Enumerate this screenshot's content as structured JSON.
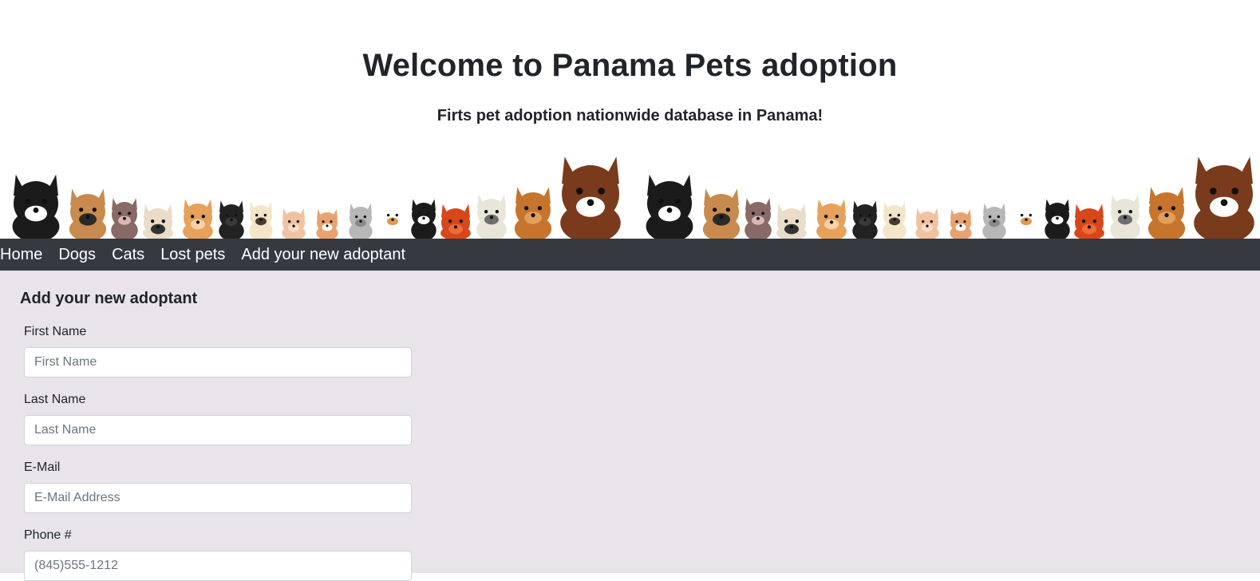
{
  "header": {
    "title": "Welcome to Panama Pets adoption",
    "subtitle": "Firts pet adoption nationwide database in Panama!"
  },
  "banner": {
    "image": "row-of-cartoon-dogs-and-cats"
  },
  "nav": {
    "items": [
      {
        "label": "Home"
      },
      {
        "label": "Dogs"
      },
      {
        "label": "Cats"
      },
      {
        "label": "Lost pets"
      },
      {
        "label": "Add your new adoptant"
      }
    ]
  },
  "form": {
    "title": "Add your new adoptant",
    "fields": [
      {
        "label": "First Name",
        "placeholder": "First Name"
      },
      {
        "label": "Last Name",
        "placeholder": "Last Name"
      },
      {
        "label": "E-Mail",
        "placeholder": "E-Mail Address"
      },
      {
        "label": "Phone #",
        "placeholder": "(845)555-1212"
      }
    ]
  },
  "colors": {
    "nav_bg": "#343a40",
    "main_bg": "#e8e4ea"
  }
}
